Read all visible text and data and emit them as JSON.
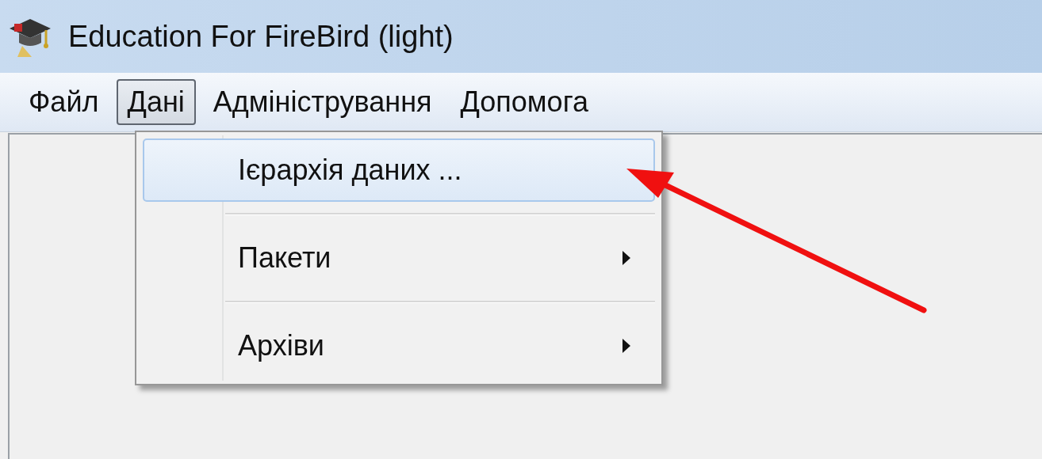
{
  "window": {
    "title": "Education For FireBird (light)"
  },
  "menu_bar": {
    "items": [
      {
        "label": "Файл",
        "selected": false
      },
      {
        "label": "Дані",
        "selected": true
      },
      {
        "label": "Адміністрування",
        "selected": false
      },
      {
        "label": "Допомога",
        "selected": false
      }
    ]
  },
  "dropdown": {
    "items": [
      {
        "kind": "item",
        "label": "Ієрархія даних ...",
        "selected": true,
        "submenu": false
      },
      {
        "kind": "separator"
      },
      {
        "kind": "item",
        "label": "Пакети",
        "selected": false,
        "submenu": true
      },
      {
        "kind": "separator"
      },
      {
        "kind": "item",
        "label": "Архіви",
        "selected": false,
        "submenu": true
      }
    ]
  }
}
